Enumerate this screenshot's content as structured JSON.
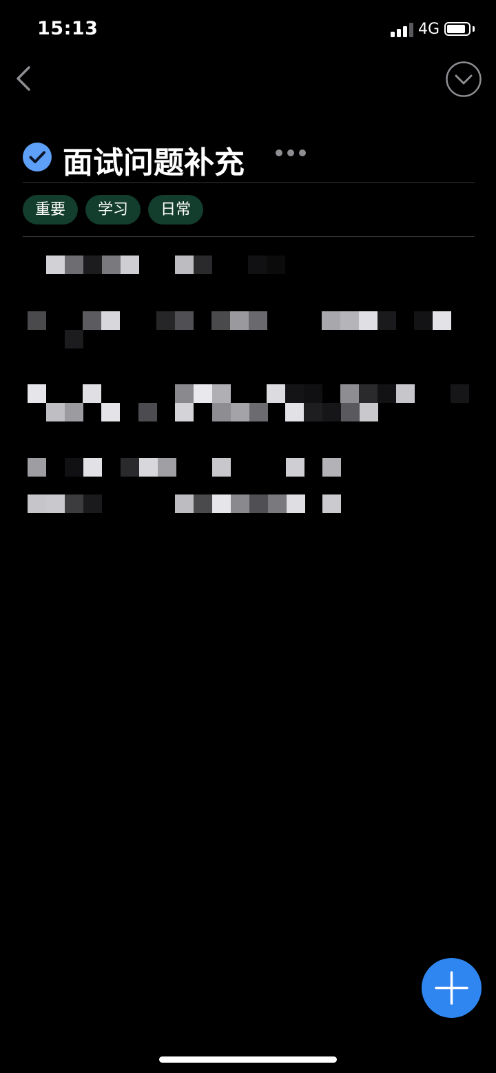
{
  "status_bar": {
    "time": "15:13",
    "network": "4G",
    "signal_bars_filled": 3,
    "signal_bars_total": 4,
    "battery_level": 0.85
  },
  "header": {
    "back_icon": "chevron-left-icon",
    "collapse_icon": "chevron-down-circle-icon"
  },
  "note": {
    "title": "面试问题补充",
    "completed": true,
    "check_color": "#5ea0f7",
    "tags": [
      {
        "label": "重要"
      },
      {
        "label": "学习"
      },
      {
        "label": "日常"
      }
    ],
    "tag_color": "#133d2c",
    "body_obscured": true
  },
  "fab": {
    "icon": "plus-icon",
    "color": "#2f86f0"
  }
}
